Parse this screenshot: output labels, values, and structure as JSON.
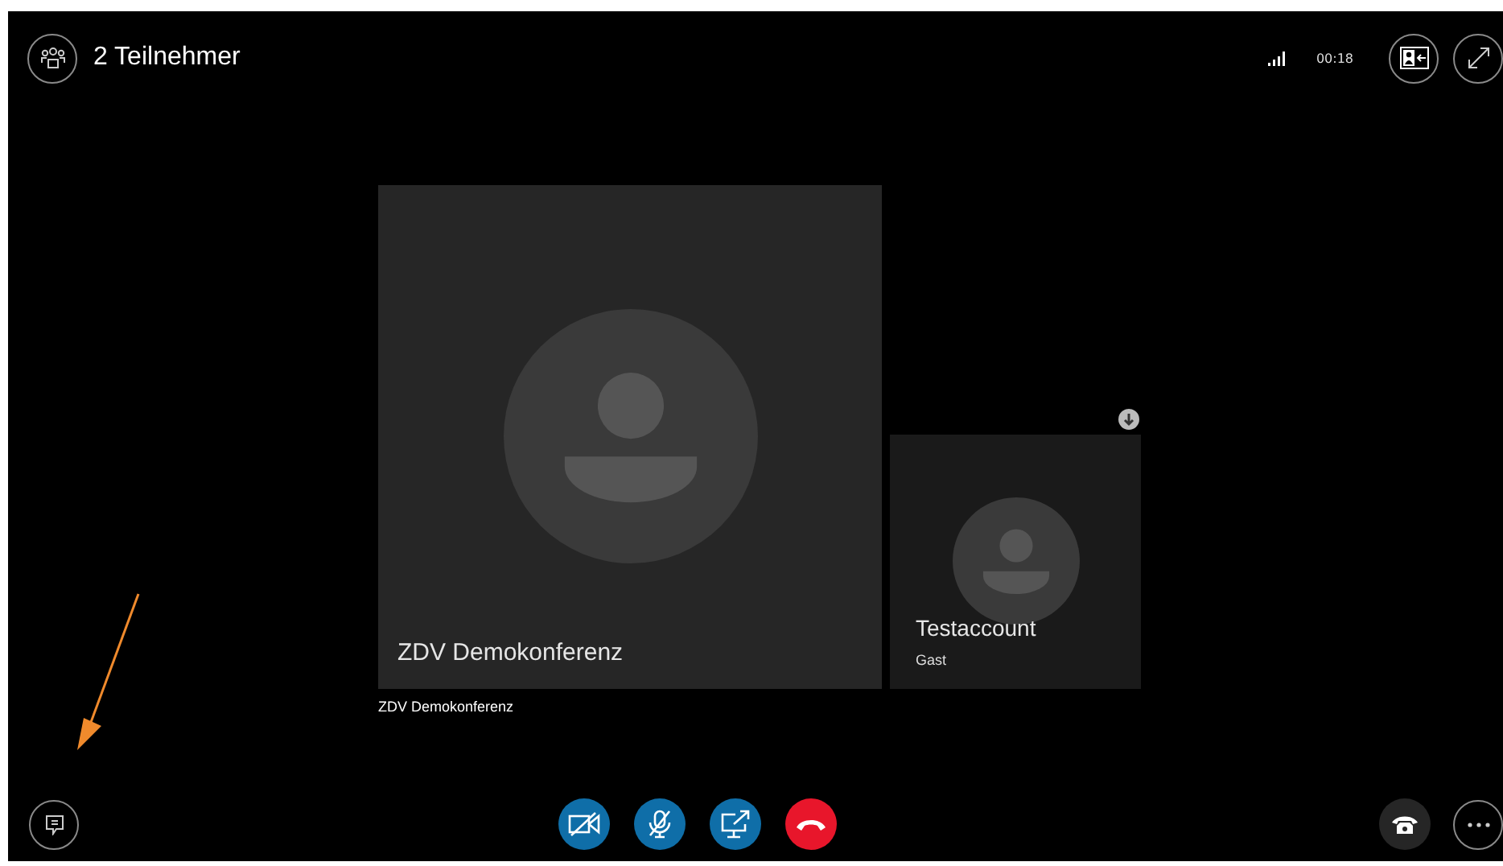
{
  "header": {
    "title": "2 Teilnehmer",
    "call_time": "00:18"
  },
  "participants": [
    {
      "name": "ZDV Demokonferenz",
      "kind": "main",
      "caption": "ZDV Demokonferenz"
    },
    {
      "name": "Testaccount",
      "kind": "thumbnail",
      "role": "Gast"
    }
  ],
  "call_controls": [
    {
      "kind": "video"
    },
    {
      "kind": "mic"
    },
    {
      "kind": "share"
    },
    {
      "kind": "hangup"
    }
  ]
}
